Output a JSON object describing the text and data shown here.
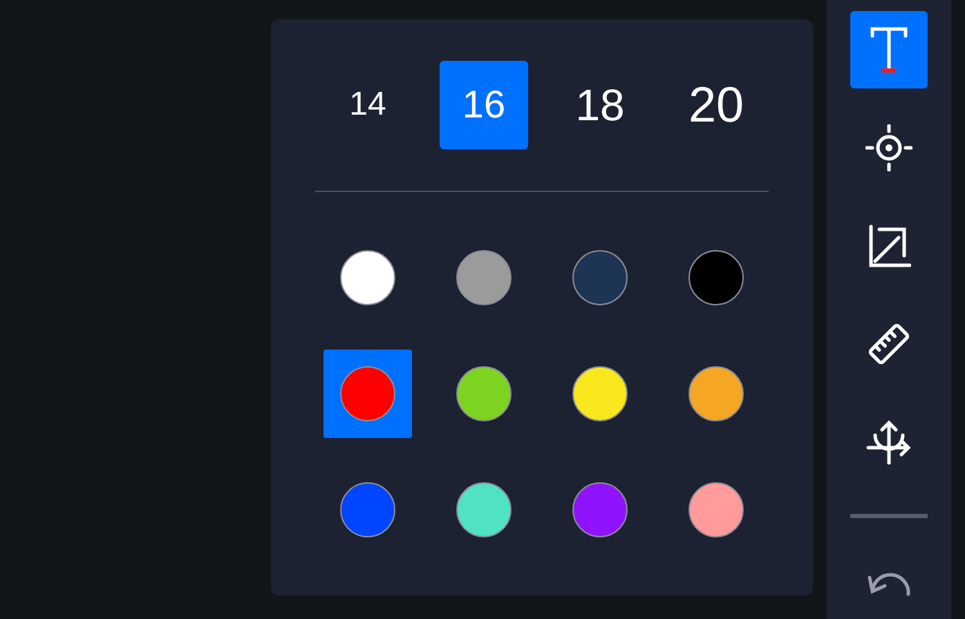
{
  "font_sizes": [
    {
      "label": "14",
      "selected": false
    },
    {
      "label": "16",
      "selected": true
    },
    {
      "label": "18",
      "selected": false
    },
    {
      "label": "20",
      "selected": false
    }
  ],
  "colors": [
    {
      "color": "#ffffff",
      "selected": false
    },
    {
      "color": "#9b9b9b",
      "selected": false
    },
    {
      "color": "#1e3454",
      "selected": false
    },
    {
      "color": "#000000",
      "selected": false
    },
    {
      "color": "#ff0000",
      "selected": true
    },
    {
      "color": "#7ed321",
      "selected": false
    },
    {
      "color": "#f8e71c",
      "selected": false
    },
    {
      "color": "#f5a623",
      "selected": false
    },
    {
      "color": "#0045ff",
      "selected": false
    },
    {
      "color": "#50e3c2",
      "selected": false
    },
    {
      "color": "#9013fe",
      "selected": false
    },
    {
      "color": "#ff9b9b",
      "selected": false
    }
  ],
  "tools": [
    {
      "kind": "text",
      "selected": true
    },
    {
      "kind": "target",
      "selected": false
    },
    {
      "kind": "resize",
      "selected": false
    },
    {
      "kind": "ruler",
      "selected": false
    },
    {
      "kind": "axes",
      "selected": false
    }
  ],
  "undo": {
    "disabled": true
  }
}
